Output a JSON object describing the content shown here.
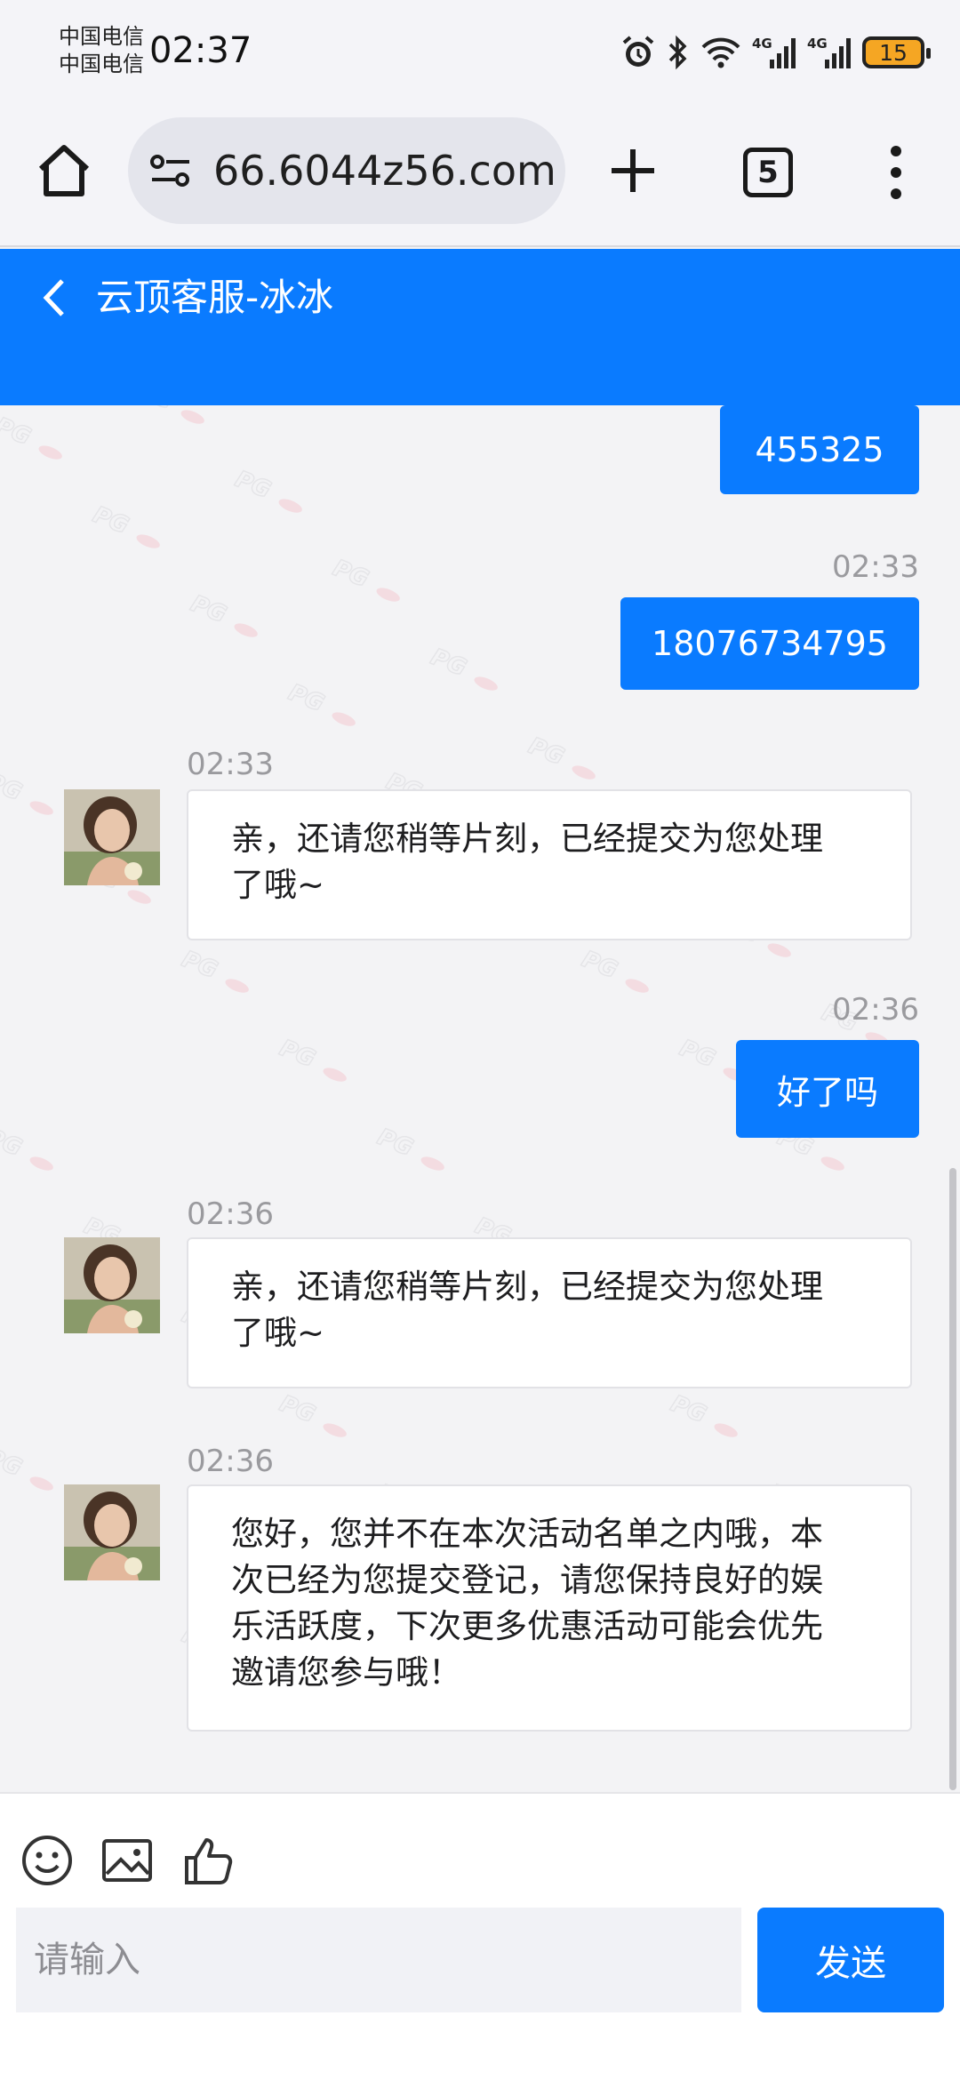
{
  "status_bar": {
    "carrier_1": "中国电信",
    "carrier_2": "中国电信",
    "time": "02:37",
    "network_1": "4G",
    "network_2": "4G",
    "battery": "15"
  },
  "browser": {
    "url": "66.6044z56.com",
    "tab_count": "5"
  },
  "chat": {
    "title": "云顶客服-冰冰"
  },
  "messages": [
    {
      "side": "out",
      "text": "455325"
    },
    {
      "side": "out",
      "time": "02:33",
      "text": "18076734795"
    },
    {
      "side": "in",
      "time": "02:33",
      "lines": [
        "亲，还请您稍等片刻，已经提交为您处理",
        "了哦~"
      ]
    },
    {
      "side": "out",
      "time": "02:36",
      "text": "好了吗"
    },
    {
      "side": "in",
      "time": "02:36",
      "lines": [
        "亲，还请您稍等片刻，已经提交为您处理",
        "了哦~"
      ]
    },
    {
      "side": "in",
      "time": "02:36",
      "lines": [
        "您好，您并不在本次活动名单之内哦，本",
        "次已经为您提交登记，请您保持良好的娱",
        "乐活跃度，下次更多优惠活动可能会优先",
        "邀请您参与哦！"
      ]
    }
  ],
  "input": {
    "placeholder": "请输入",
    "send_label": "发送"
  },
  "watermark": "PG",
  "colors": {
    "accent": "#0a7bff",
    "battery": "#f5a623"
  }
}
